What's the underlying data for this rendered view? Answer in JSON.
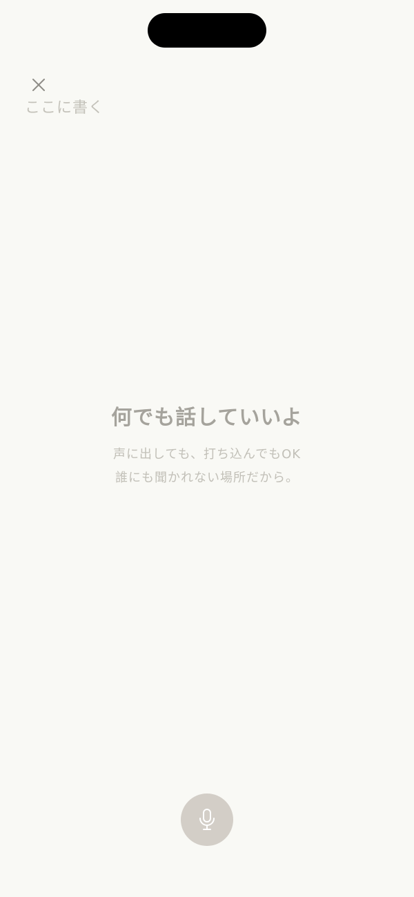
{
  "compose": {
    "placeholder": "ここに書く",
    "value": ""
  },
  "empty_state": {
    "title": "何でも話していいよ",
    "subtitle_line1": "声に出しても、打ち込んでもOK",
    "subtitle_line2": "誰にも聞かれない場所だから。"
  },
  "icons": {
    "close": "close-icon",
    "mic": "microphone-icon"
  },
  "colors": {
    "background": "#f9f9f5",
    "title": "#a5a39c",
    "subtitle": "#c2c0b8",
    "placeholder": "#c4c2ba",
    "mic_button": "#d3cec7",
    "close_icon": "#8e8c86"
  }
}
